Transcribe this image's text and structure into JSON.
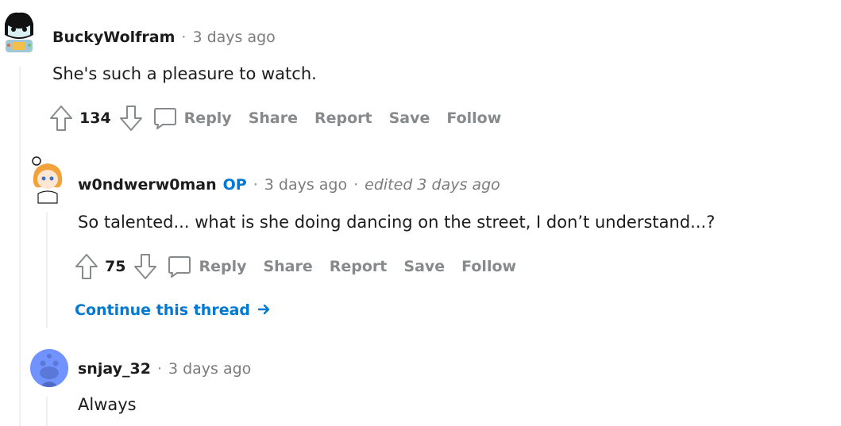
{
  "comments": [
    {
      "author": "BuckyWolfram",
      "sep": "·",
      "time": "3 days ago",
      "body": "She's such a pleasure to watch.",
      "score": "134",
      "actions": {
        "reply": "Reply",
        "share": "Share",
        "report": "Report",
        "save": "Save",
        "follow": "Follow"
      }
    },
    {
      "author": "w0ndwerw0man",
      "op": "OP",
      "sep": "·",
      "time": "3 days ago",
      "sep2": "·",
      "edited": "edited 3 days ago",
      "body": "So talented... what is she doing dancing on the street, I don’t understand...?",
      "score": "75",
      "actions": {
        "reply": "Reply",
        "share": "Share",
        "report": "Report",
        "save": "Save",
        "follow": "Follow"
      },
      "continue": "Continue this thread"
    },
    {
      "author": "snjay_32",
      "sep": "·",
      "time": "3 days ago",
      "body": "Always"
    }
  ],
  "colors": {
    "op": "#0079d3",
    "link": "#0079d3",
    "muted": "#878a8c",
    "thread_line": "#edeff1"
  }
}
